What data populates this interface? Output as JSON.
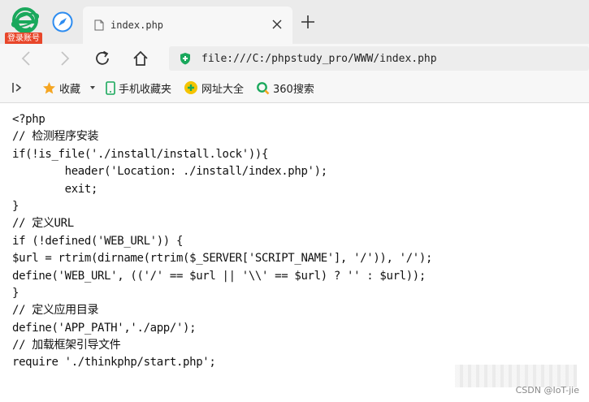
{
  "browser": {
    "login_badge": "登录账号",
    "tab": {
      "title": "index.php"
    },
    "address": "file:///C:/phpstudy_pro/WWW/index.php",
    "bookmarks": [
      {
        "label": "收藏",
        "icon": "star-icon",
        "has_dropdown": true
      },
      {
        "label": "手机收藏夹",
        "icon": "phone-icon"
      },
      {
        "label": "网址大全",
        "icon": "web-directory-icon"
      },
      {
        "label": "360搜索",
        "icon": "search-icon"
      }
    ]
  },
  "code_lines": [
    "<?php",
    "// 检测程序安装",
    "if(!is_file('./install/install.lock')){",
    "        header('Location: ./install/index.php');",
    "        exit;",
    "}",
    "// 定义URL",
    "if (!defined('WEB_URL')) {",
    "$url = rtrim(dirname(rtrim($_SERVER['SCRIPT_NAME'], '/')), '/');",
    "define('WEB_URL', (('/' == $url || '\\\\' == $url) ? '' : $url));",
    "}",
    "// 定义应用目录",
    "define('APP_PATH','./app/');",
    "// 加载框架引导文件",
    "require './thinkphp/start.php';"
  ],
  "watermark": "CSDN @IoT-jie",
  "colors": {
    "logo_green": "#1aa85c",
    "compass_blue": "#2d8cf0",
    "badge_red": "#e8462a",
    "star_orange": "#f5a623"
  }
}
